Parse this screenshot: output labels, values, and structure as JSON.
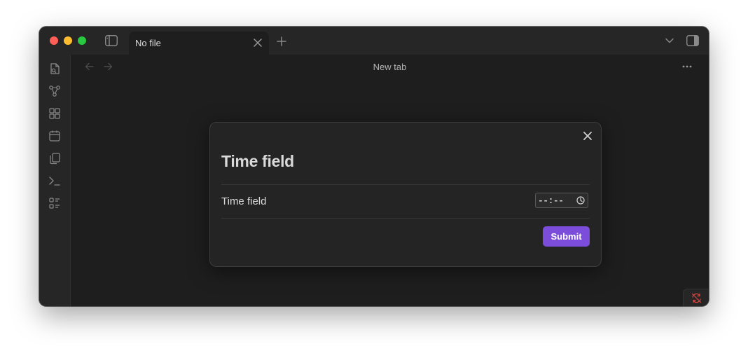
{
  "window": {
    "tab": {
      "title": "No file"
    },
    "view_title": "New tab"
  },
  "sidebar": {
    "items": [
      {
        "icon": "files-icon"
      },
      {
        "icon": "graph-icon"
      },
      {
        "icon": "canvas-icon"
      },
      {
        "icon": "calendar-icon"
      },
      {
        "icon": "templates-icon"
      },
      {
        "icon": "terminal-icon"
      },
      {
        "icon": "list-icon"
      }
    ]
  },
  "modal": {
    "title": "Time field",
    "field_label": "Time field",
    "time_placeholder": "--:--",
    "submit_label": "Submit"
  },
  "colors": {
    "accent": "#7c4ddb",
    "background": "#1e1e1e",
    "sync_error": "#e0443e"
  }
}
